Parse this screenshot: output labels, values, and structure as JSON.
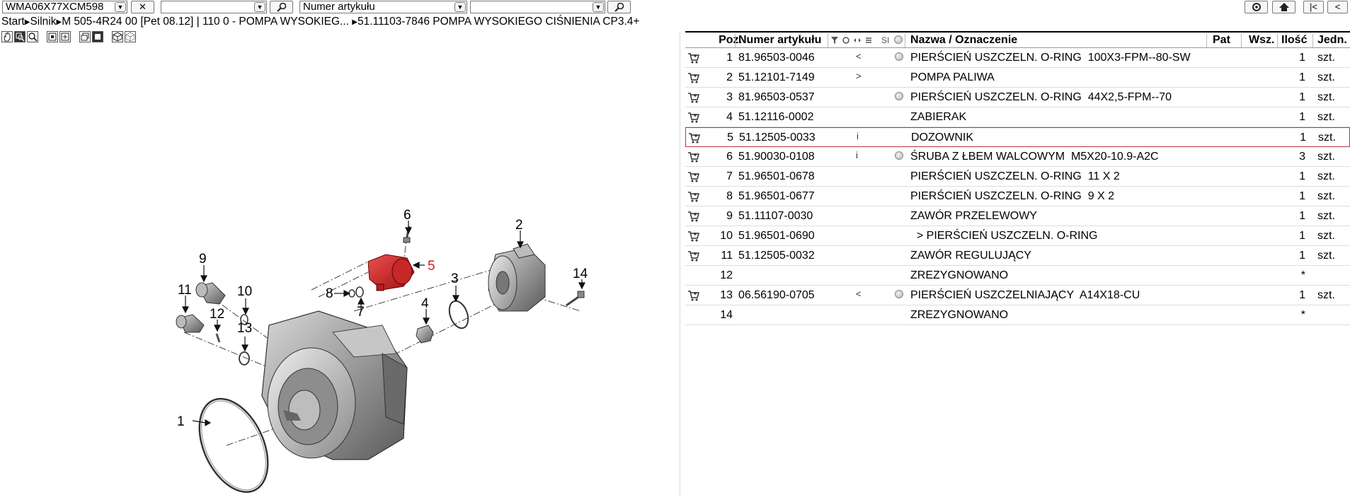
{
  "toolbar": {
    "vin": "WMA06X77XCM598",
    "field2": "",
    "search_type": "Numer artykułu",
    "field4": "",
    "clear_icon": "close-icon",
    "search_icon": "magnifier-icon"
  },
  "breadcrumb": {
    "start": "Start",
    "engine": "Silnik",
    "model": "M 505-4R24 00  [Pet 08.12]  | 110 0 - POMPA WYSOKIEG...",
    "part": "51.11103-7846  POMPA WYSOKIEGO CIŚNIENIA  CP3.4+"
  },
  "drawing": {
    "callouts": [
      "1",
      "2",
      "3",
      "4",
      "5",
      "6",
      "7",
      "8",
      "9",
      "10",
      "11",
      "12",
      "13",
      "14"
    ],
    "highlight_color": "#d42020"
  },
  "table": {
    "headers": {
      "pos": "Poz.",
      "number": "Numer artykułu",
      "si": "SI",
      "name": "Nazwa / Oznaczenie",
      "pat": "Pat",
      "wsz": "Wsz.",
      "qty": "Ilość",
      "unit": "Jedn."
    },
    "rows": [
      {
        "pos": "1",
        "number": "81.96503-0046",
        "mark": "<",
        "disc": true,
        "name": "PIERŚCIEŃ USZCZELN. O-RING  100X3-FPM--80-SW",
        "qty": "1",
        "unit": "szt.",
        "cart": true
      },
      {
        "pos": "2",
        "number": "51.12101-7149",
        "mark": ">",
        "disc": false,
        "name": "POMPA PALIWA",
        "qty": "1",
        "unit": "szt.",
        "cart": true
      },
      {
        "pos": "3",
        "number": "81.96503-0537",
        "mark": "",
        "disc": true,
        "name": "PIERŚCIEŃ USZCZELN. O-RING  44X2,5-FPM--70",
        "qty": "1",
        "unit": "szt.",
        "cart": true
      },
      {
        "pos": "4",
        "number": "51.12116-0002",
        "mark": "",
        "disc": false,
        "name": "ZABIERAK",
        "qty": "1",
        "unit": "szt.",
        "cart": true
      },
      {
        "pos": "5",
        "number": "51.12505-0033",
        "mark": "i",
        "disc": false,
        "name": "DOZOWNIK",
        "qty": "1",
        "unit": "szt.",
        "cart": true,
        "selected": true
      },
      {
        "pos": "6",
        "number": "51.90030-0108",
        "mark": "i",
        "disc": true,
        "name": "ŚRUBA Z ŁBEM WALCOWYM  M5X20-10.9-A2C",
        "qty": "3",
        "unit": "szt.",
        "cart": true
      },
      {
        "pos": "7",
        "number": "51.96501-0678",
        "mark": "",
        "disc": false,
        "name": "PIERŚCIEŃ USZCZELN. O-RING  11 X 2",
        "qty": "1",
        "unit": "szt.",
        "cart": true
      },
      {
        "pos": "8",
        "number": "51.96501-0677",
        "mark": "",
        "disc": false,
        "name": "PIERŚCIEŃ USZCZELN. O-RING  9 X 2",
        "qty": "1",
        "unit": "szt.",
        "cart": true
      },
      {
        "pos": "9",
        "number": "51.11107-0030",
        "mark": "",
        "disc": false,
        "name": "ZAWÓR PRZELEWOWY",
        "qty": "1",
        "unit": "szt.",
        "cart": true
      },
      {
        "pos": "10",
        "number": "51.96501-0690",
        "mark": "",
        "disc": false,
        "name": "  > PIERŚCIEŃ USZCZELN. O-RING",
        "qty": "1",
        "unit": "szt.",
        "cart": true
      },
      {
        "pos": "11",
        "number": "51.12505-0032",
        "mark": "",
        "disc": false,
        "name": "ZAWÓR REGULUJĄCY",
        "qty": "1",
        "unit": "szt.",
        "cart": true
      },
      {
        "pos": "12",
        "number": "",
        "mark": "",
        "disc": false,
        "name": "ZREZYGNOWANO",
        "qty": "*",
        "unit": "",
        "cart": false
      },
      {
        "pos": "13",
        "number": "06.56190-0705",
        "mark": "<",
        "disc": true,
        "name": "PIERŚCIEŃ USZCZELNIAJĄCY  A14X18-CU",
        "qty": "1",
        "unit": "szt.",
        "cart": true
      },
      {
        "pos": "14",
        "number": "",
        "mark": "",
        "disc": false,
        "name": "ZREZYGNOWANO",
        "qty": "*",
        "unit": "",
        "cart": false
      }
    ]
  }
}
